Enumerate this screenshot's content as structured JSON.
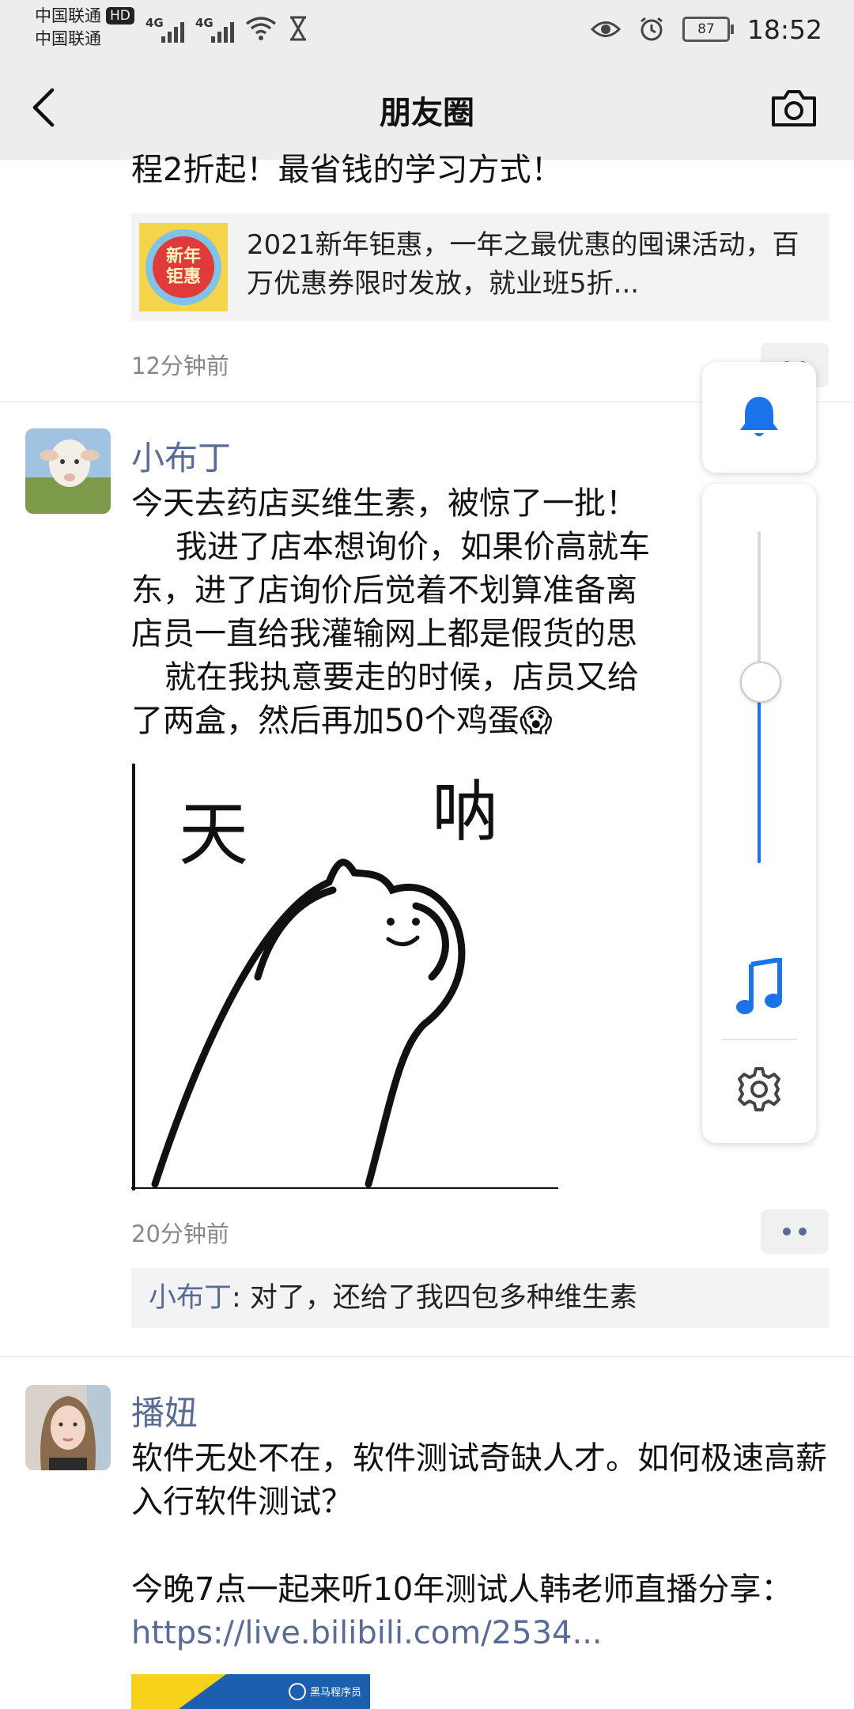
{
  "status_bar": {
    "carrier_1": "中国联通",
    "hd_badge": "HD",
    "carrier_2": "中国联通",
    "network_1": "4G",
    "network_2": "4G",
    "battery": "87",
    "time": "18:52"
  },
  "nav": {
    "title": "朋友圈"
  },
  "post_partial": {
    "text_tail": "程2折起！最省钱的学习方式！",
    "link_card": {
      "thumb_text_1": "新年",
      "thumb_text_2": "钜惠",
      "title": "2021新年钜惠，一年之最优惠的囤课活动，百万优惠券限时发放，就业班5折..."
    },
    "time": "12分钟前"
  },
  "post_1": {
    "author": "小布丁",
    "text_lines": [
      "今天去药店买维生素，被惊了一批！",
      "我进了店本想询价，如果价高就车",
      "东，进了店询价后觉着不划算准备离",
      "店员一直给我灌输网上都是假货的思",
      "就在我执意要走的时候，店员又给",
      "了两盒，然后再加50个鸡蛋😱"
    ],
    "image_text_1": "天",
    "image_text_2": "呐",
    "time": "20分钟前",
    "comment_author": "小布丁",
    "comment_text": ": 对了，还给了我四包多种维生素"
  },
  "post_2": {
    "author": "播妞",
    "text_line_1": "软件无处不在，软件测试奇缺人才。如何极速高薪入行软件测试？",
    "text_line_2_prefix": "今晚7点一起来听10年测试人韩老师直播分享：",
    "link": "https://live.bilibili.com/2534...",
    "thumb_label": "黑马程序员"
  },
  "volume_panel": {
    "level": 0.55,
    "bell_icon": "bell-icon",
    "music_icon": "music-note-icon",
    "settings_icon": "gear-icon"
  },
  "colors": {
    "name_blue": "#576b95",
    "accent_blue": "#1a73e8",
    "bar_gray": "#ededed"
  }
}
